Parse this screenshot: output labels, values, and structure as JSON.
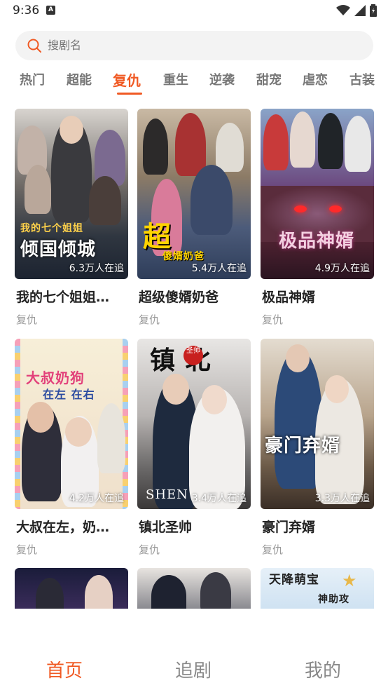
{
  "status": {
    "time": "9:36",
    "notif_icon": "A"
  },
  "search": {
    "placeholder": "搜剧名"
  },
  "tabs": [
    "热门",
    "超能",
    "复仇",
    "重生",
    "逆袭",
    "甜宠",
    "虐恋",
    "古装"
  ],
  "active_tab": "复仇",
  "cards": [
    {
      "title": "我的七个姐姐…",
      "genre": "复仇",
      "followers": "6.3万人在追",
      "art_line1": "我的七个姐姐",
      "art_line2": "倾国倾城"
    },
    {
      "title": "超级傻婿奶爸",
      "genre": "复仇",
      "followers": "5.4万人在追",
      "art_line1": "超",
      "art_line2": "傻婿奶爸"
    },
    {
      "title": "极品神婿",
      "genre": "复仇",
      "followers": "4.9万人在追",
      "art_line1": "极品神婿",
      "art_line2": ""
    },
    {
      "title": "大叔在左，奶…",
      "genre": "复仇",
      "followers": "4.2万人在追",
      "art_line1": "大叔奶狗",
      "art_line2": "在左 在右"
    },
    {
      "title": "镇北圣帅",
      "genre": "复仇",
      "followers": "3.4万人在追",
      "art_line1": "镇 北",
      "art_line2": "圣帅",
      "art_line3": "SHEN"
    },
    {
      "title": "豪门弃婿",
      "genre": "复仇",
      "followers": "3.3万人在追",
      "art_line1": "豪门弃婿",
      "art_line2": ""
    }
  ],
  "partial_cards": [
    {
      "art_line1": ""
    },
    {
      "art_line1": ""
    },
    {
      "art_line1": "天降萌宝",
      "art_line2": "神助攻"
    }
  ],
  "bottom_nav": {
    "home": "首页",
    "following": "追剧",
    "me": "我的"
  },
  "colors": {
    "accent": "#f05a24",
    "search_bg": "#f3f3f3",
    "genre": "#9a9a9a"
  }
}
